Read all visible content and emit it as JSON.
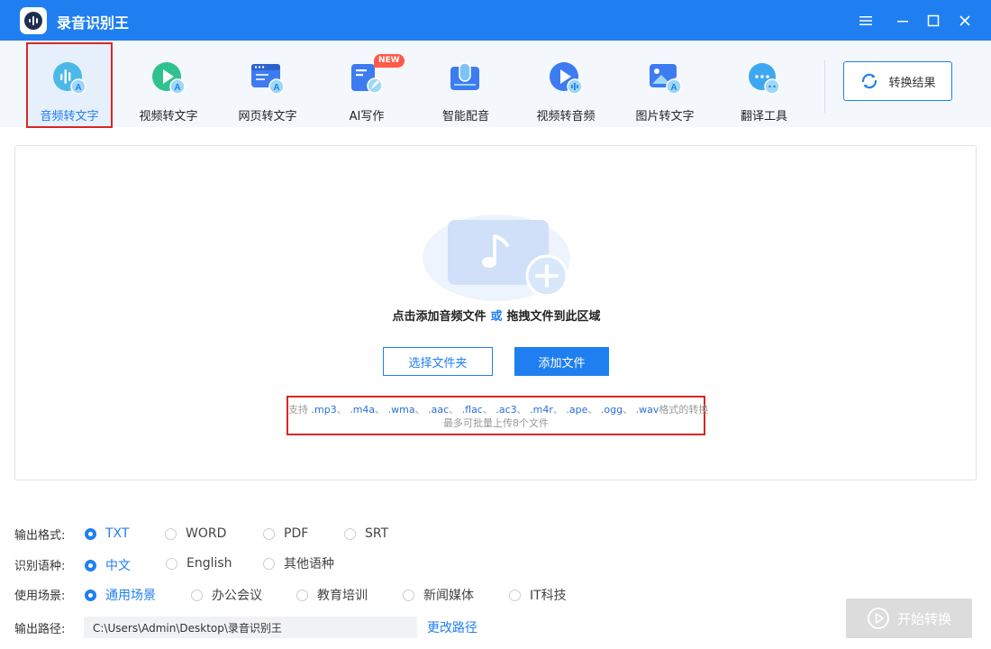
{
  "window": {
    "title": "录音识别王"
  },
  "toolbar": {
    "items": [
      {
        "label": "音频转文字",
        "icon": "audio-to-text-icon",
        "active": true
      },
      {
        "label": "视频转文字",
        "icon": "video-to-text-icon",
        "active": false
      },
      {
        "label": "网页转文字",
        "icon": "webpage-to-text-icon",
        "active": false
      },
      {
        "label": "AI写作",
        "icon": "ai-writing-icon",
        "active": false,
        "badge": "NEW"
      },
      {
        "label": "智能配音",
        "icon": "smart-dubbing-icon",
        "active": false
      },
      {
        "label": "视频转音频",
        "icon": "video-to-audio-icon",
        "active": false
      },
      {
        "label": "图片转文字",
        "icon": "image-to-text-icon",
        "active": false
      },
      {
        "label": "翻译工具",
        "icon": "translate-icon",
        "active": false
      }
    ],
    "result_button": "转换结果"
  },
  "drop": {
    "text_a": "点击添加音频文件",
    "text_or": "或",
    "text_b": "拖拽文件到此区域",
    "select_folder": "选择文件夹",
    "add_file": "添加文件",
    "support_prefix": "支持",
    "formats": [
      ".mp3",
      ".m4a",
      ".wma",
      ".aac",
      ".flac",
      ".ac3",
      ".m4r",
      ".ape",
      ".ogg",
      ".wav"
    ],
    "separator": "、",
    "support_suffix": "格式的转换",
    "limit": "最多可批量上传8个文件"
  },
  "options": {
    "format_label": "输出格式:",
    "formats": [
      {
        "label": "TXT",
        "selected": true
      },
      {
        "label": "WORD",
        "selected": false
      },
      {
        "label": "PDF",
        "selected": false
      },
      {
        "label": "SRT",
        "selected": false
      }
    ],
    "language_label": "识别语种:",
    "languages": [
      {
        "label": "中文",
        "selected": true
      },
      {
        "label": "English",
        "selected": false
      },
      {
        "label": "其他语种",
        "selected": false
      }
    ],
    "scene_label": "使用场景:",
    "scenes": [
      {
        "label": "通用场景",
        "selected": true
      },
      {
        "label": "办公会议",
        "selected": false
      },
      {
        "label": "教育培训",
        "selected": false
      },
      {
        "label": "新闻媒体",
        "selected": false
      },
      {
        "label": "IT科技",
        "selected": false
      }
    ],
    "path_label": "输出路径:",
    "path_value": "C:\\Users\\Admin\\Desktop\\录音识别王",
    "change_path": "更改路径"
  },
  "start_button": "开始转换",
  "colors": {
    "accent": "#1f7ff0",
    "highlight_outline": "#d92626",
    "badge": "#ff5a4a",
    "disabled": "#dcdcdc"
  }
}
